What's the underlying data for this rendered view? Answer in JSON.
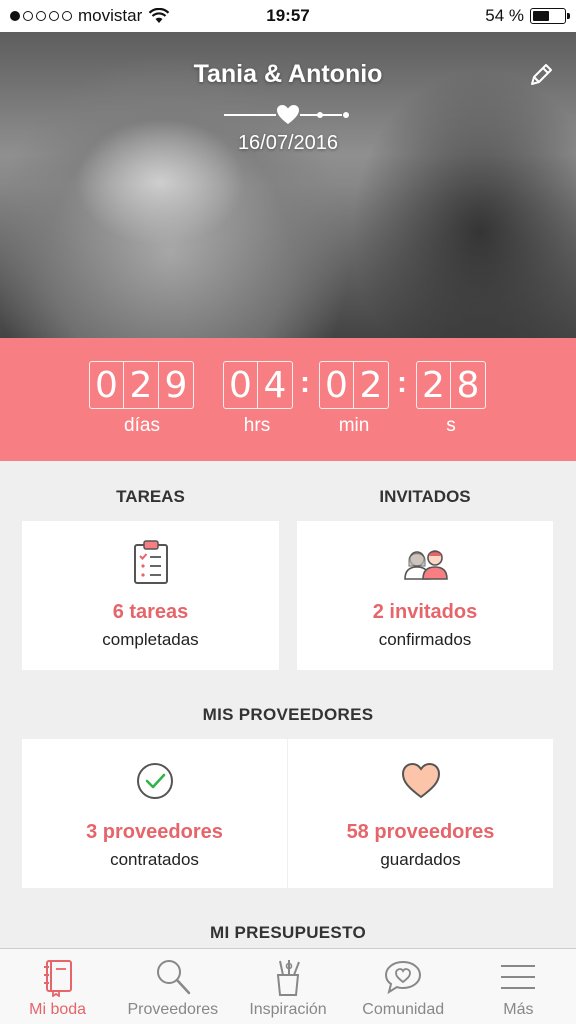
{
  "status_bar": {
    "carrier": "movistar",
    "signal_bars": 1,
    "time": "19:57",
    "battery_percent": "54 %",
    "battery_level": 0.54
  },
  "hero": {
    "couple_names": "Tania & Antonio",
    "wedding_date": "16/07/2016"
  },
  "countdown": {
    "days": [
      "0",
      "2",
      "9"
    ],
    "hours": [
      "0",
      "4"
    ],
    "minutes": [
      "0",
      "2"
    ],
    "seconds": [
      "2",
      "8"
    ],
    "days_label": "días",
    "hours_label": "hrs",
    "minutes_label": "min",
    "seconds_label": "s"
  },
  "tasks": {
    "title": "TAREAS",
    "count": "6 tareas",
    "subtitle": "completadas"
  },
  "guests": {
    "title": "INVITADOS",
    "count": "2 invitados",
    "subtitle": "confirmados"
  },
  "vendors": {
    "title": "MIS PROVEEDORES",
    "hired_count": "3 proveedores",
    "hired_subtitle": "contratados",
    "saved_count": "58 proveedores",
    "saved_subtitle": "guardados"
  },
  "budget": {
    "title": "MI PRESUPUESTO"
  },
  "tabbar": {
    "items": [
      {
        "label": "Mi boda",
        "icon": "notebook-icon",
        "active": true
      },
      {
        "label": "Proveedores",
        "icon": "search-icon",
        "active": false
      },
      {
        "label": "Inspiración",
        "icon": "brush-cup-icon",
        "active": false
      },
      {
        "label": "Comunidad",
        "icon": "chat-heart-icon",
        "active": false
      },
      {
        "label": "Más",
        "icon": "menu-icon",
        "active": false
      }
    ]
  },
  "colors": {
    "accent": "#f77f83",
    "accent_text": "#e6656a",
    "background": "#efefef"
  }
}
